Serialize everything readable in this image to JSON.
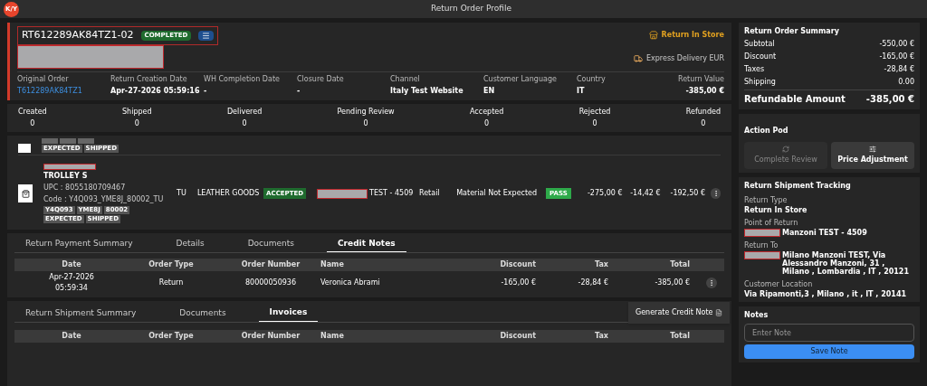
{
  "top_bar": {
    "logo": "K/Y",
    "title": "Return Order Profile"
  },
  "header": {
    "order_id": "RT612289AK84TZ1-02",
    "status": "COMPLETED",
    "return_type": "Return In Store",
    "delivery": "Express Delivery EUR",
    "fields": [
      {
        "label": "Original Order",
        "value": "T612289AK84TZ1",
        "kind": "link"
      },
      {
        "label": "Return Creation Date",
        "value": "Apr-27-2026 05:59:16",
        "kind": "text"
      },
      {
        "label": "WH Completion Date",
        "value": "-",
        "kind": "text"
      },
      {
        "label": "Closure Date",
        "value": "-",
        "kind": "text"
      },
      {
        "label": "Channel",
        "value": "Italy Test Website",
        "kind": "text"
      },
      {
        "label": "Customer Language",
        "value": "EN",
        "kind": "text"
      },
      {
        "label": "Country",
        "value": "IT",
        "kind": "text"
      },
      {
        "label": "Return Value",
        "value": "-385,00 €",
        "kind": "text"
      }
    ]
  },
  "stats": [
    {
      "label": "Created",
      "value": "0"
    },
    {
      "label": "Shipped",
      "value": "0"
    },
    {
      "label": "Delivered",
      "value": "0"
    },
    {
      "label": "Pending Review",
      "value": "0"
    },
    {
      "label": "Accepted",
      "value": "0"
    },
    {
      "label": "Rejected",
      "value": "0"
    },
    {
      "label": "Refunded",
      "value": "0"
    }
  ],
  "items": [
    {
      "kind": "partial",
      "tags": [
        "EXPECTED",
        "SHIPPED"
      ]
    },
    {
      "kind": "full",
      "name": "TROLLEY S",
      "upc": "UPC : 8055180709467",
      "code": "Code : Y4Q093_YME8J_80002_TU",
      "attributes": [
        "Y4Q093",
        "YME8J",
        "80002"
      ],
      "tags": [
        "EXPECTED",
        "SHIPPED"
      ],
      "size": "TU",
      "category": "LEATHER GOODS",
      "status": "ACCEPTED",
      "store": "TEST - 4509",
      "channel": "Retail",
      "reason": "Material Not Expected",
      "check": "PASS",
      "price": "-275,00 €",
      "tax": "-14,42 €",
      "total": "-192,50 €"
    }
  ],
  "payment_panel": {
    "tabs": [
      {
        "label": "Return Payment Summary",
        "selected": false
      },
      {
        "label": "Details",
        "selected": false
      },
      {
        "label": "Documents",
        "selected": false
      },
      {
        "label": "Credit Notes",
        "selected": true
      }
    ],
    "columns": [
      "Date",
      "Order Type",
      "Order Number",
      "Name",
      "Discount",
      "Tax",
      "Total"
    ],
    "rows": [
      {
        "date": "Apr-27-2026",
        "time": "05:59:34",
        "order_type": "Return",
        "order_number": "80000050936",
        "name": "Veronica Abrami",
        "discount": "-165,00 €",
        "tax": "-28,84 €",
        "total": "-385,00 €"
      }
    ],
    "menu": [
      "Generate Credit Note"
    ]
  },
  "shipment_panel": {
    "tabs": [
      {
        "label": "Return Shipment Summary",
        "selected": false
      },
      {
        "label": "Documents",
        "selected": false
      },
      {
        "label": "Invoices",
        "selected": true
      }
    ],
    "columns": [
      "Date",
      "Order Type",
      "Order Number",
      "Name",
      "Discount",
      "Tax",
      "Total"
    ]
  },
  "summary": {
    "title": "Return Order Summary",
    "rows": [
      {
        "label": "Subtotal",
        "value": "-550,00 €"
      },
      {
        "label": "Discount",
        "value": "-165,00 €"
      },
      {
        "label": "Taxes",
        "value": "-28,84 €"
      },
      {
        "label": "Shipping",
        "value": "0.00"
      }
    ],
    "total_label": "Refundable Amount",
    "total_value": "-385,00 €"
  },
  "action_pod": {
    "title": "Action Pod",
    "actions": [
      {
        "label": "Complete Review",
        "disabled": true
      },
      {
        "label": "Price Adjustment",
        "disabled": false
      }
    ]
  },
  "tracking": {
    "title": "Return Shipment Tracking",
    "fields": [
      {
        "label": "Return Type",
        "value": "Return In Store",
        "redacted": false
      },
      {
        "label": "Point of Return",
        "value": "Manzoni TEST - 4509",
        "redacted": true
      },
      {
        "label": "Return To",
        "value": "Milano Manzoni TEST, Via Alessandro Manzoni, 31 , Milano , Lombardia , IT , 20121",
        "redacted": true
      },
      {
        "label": "Customer Location",
        "value": "Via Ripamonti,3 , Milano , it , IT , 20141",
        "redacted": false
      }
    ]
  },
  "notes": {
    "title": "Notes",
    "placeholder": "Enter Note",
    "button": "Save Note"
  }
}
